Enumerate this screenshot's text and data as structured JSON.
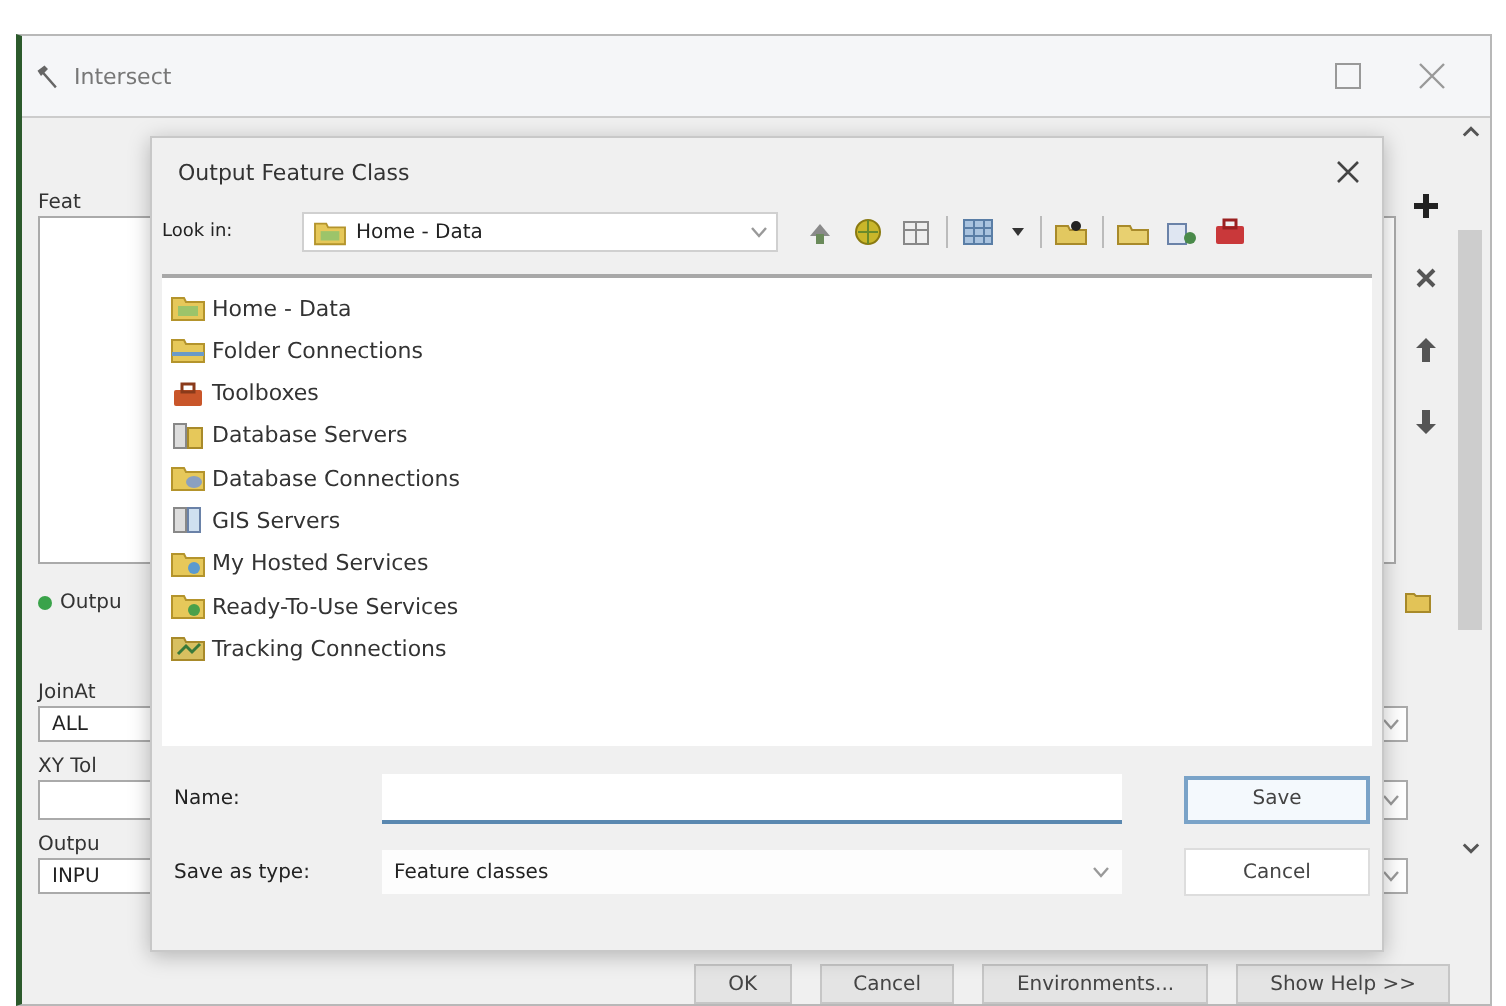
{
  "window": {
    "title": "Intersect"
  },
  "tool_form": {
    "input_label": "Feat",
    "output_label": "Outpu",
    "join_label": "JoinAt",
    "join_value": "ALL",
    "tolerance_label": "XY Tol",
    "output_type_label": "Outpu",
    "output_type_value": "INPU"
  },
  "buttons": [
    {
      "label": "OK"
    },
    {
      "label": "Cancel"
    },
    {
      "label": "Environments..."
    },
    {
      "label": "Show Help >>"
    }
  ],
  "dialog": {
    "title": "Output Feature Class",
    "look_in_label": "Look in:",
    "look_in_value": "Home - Data",
    "items": [
      {
        "label": "Home - Data"
      },
      {
        "label": "Folder Connections"
      },
      {
        "label": "Toolboxes"
      },
      {
        "label": "Database Servers"
      },
      {
        "label": "Database Connections"
      },
      {
        "label": "GIS Servers"
      },
      {
        "label": "My Hosted Services"
      },
      {
        "label": "Ready-To-Use Services"
      },
      {
        "label": "Tracking Connections"
      }
    ],
    "name_label": "Name:",
    "type_label": "Save as type:",
    "type_value": "Feature classes",
    "buttons": [
      {
        "label": "Save",
        "default": true
      },
      {
        "label": "Cancel",
        "default": false
      }
    ]
  }
}
